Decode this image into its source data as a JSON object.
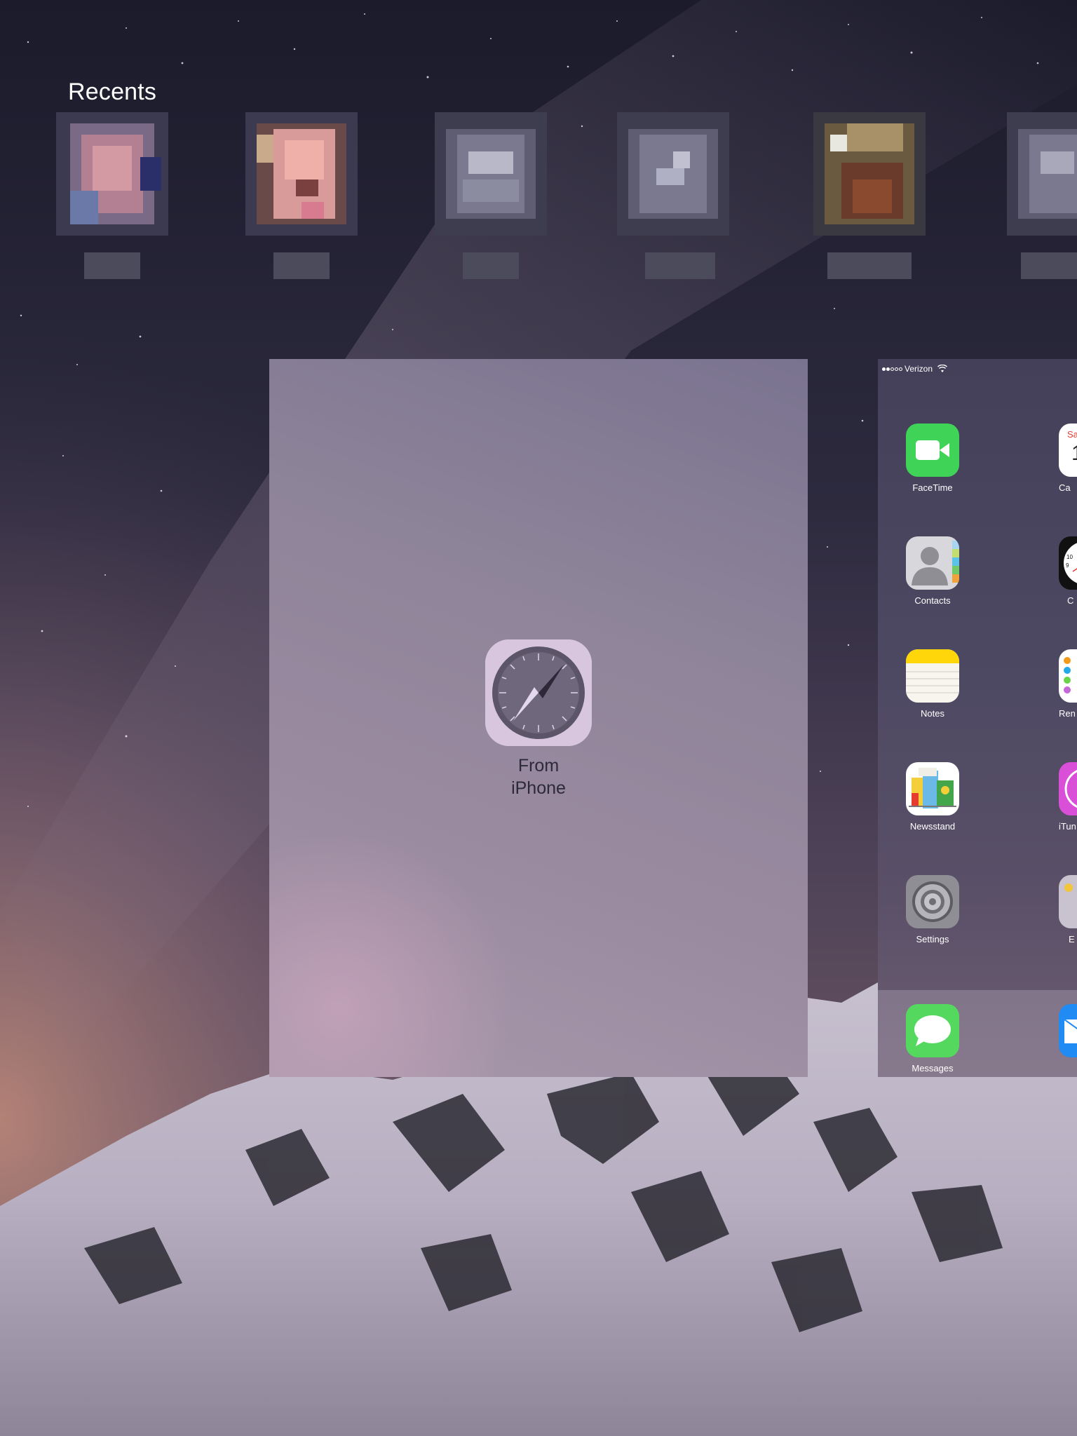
{
  "recents": {
    "title": "Recents",
    "contacts": [
      {
        "name": "",
        "avatar": "pixelated-photo"
      },
      {
        "name": "",
        "avatar": "pixelated-photo"
      },
      {
        "name": "",
        "avatar": "pixelated-placeholder"
      },
      {
        "name": "",
        "avatar": "pixelated-placeholder"
      },
      {
        "name": "",
        "avatar": "pixelated-photo"
      },
      {
        "name": "",
        "avatar": "pixelated-placeholder"
      }
    ]
  },
  "handoff": {
    "app_icon": "safari-compass-icon",
    "label_line1": "From",
    "label_line2": "iPhone"
  },
  "home_screen": {
    "status": {
      "carrier": "Verizon",
      "signal_bars": 2,
      "signal_total": 5
    },
    "apps": [
      {
        "label": "FaceTime",
        "icon": "facetime-icon"
      },
      {
        "label": "Contacts",
        "icon": "contacts-icon"
      },
      {
        "label": "Notes",
        "icon": "notes-icon"
      },
      {
        "label": "Newsstand",
        "icon": "newsstand-icon"
      },
      {
        "label": "Settings",
        "icon": "settings-icon"
      }
    ],
    "partial_apps": [
      {
        "label": "Ca",
        "icon": "calendar-icon",
        "icon_text": "Sa"
      },
      {
        "label": "C",
        "icon": "clock-icon"
      },
      {
        "label": "Ren",
        "icon": "reminders-icon"
      },
      {
        "label": "iTun",
        "icon": "itunes-icon"
      },
      {
        "label": "E",
        "icon": "ibooks-icon"
      }
    ],
    "dock": [
      {
        "label": "Messages",
        "icon": "messages-icon"
      },
      {
        "label": "",
        "icon": "mail-icon"
      }
    ]
  },
  "colors": {
    "facetime_green": "#3fd458",
    "messages_green": "#55d85e",
    "notes_yellow": "#ffd60a",
    "itunes_pink": "#d94fd7",
    "mail_blue": "#1f8bf3"
  }
}
